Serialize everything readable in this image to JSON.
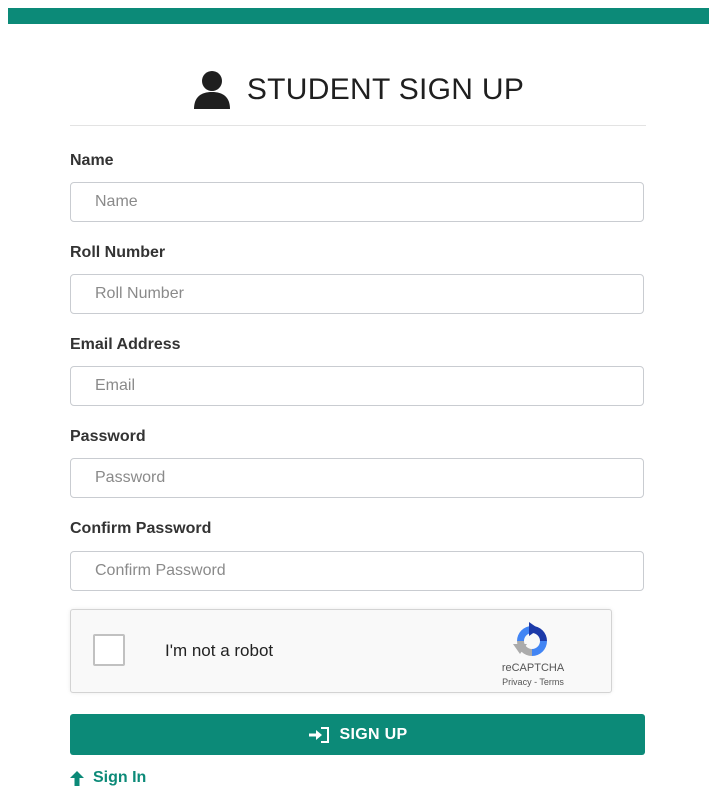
{
  "colors": {
    "brand": "#0c8a78",
    "text": "#333333",
    "input_border": "#c9ccd1"
  },
  "header": {
    "title": "STUDENT SIGN UP",
    "icon": "user-icon"
  },
  "form": {
    "name": {
      "label": "Name",
      "placeholder": "Name",
      "value": ""
    },
    "roll_number": {
      "label": "Roll Number",
      "placeholder": "Roll Number",
      "value": ""
    },
    "email": {
      "label": "Email Address",
      "placeholder": "Email",
      "value": ""
    },
    "password": {
      "label": "Password",
      "placeholder": "Password",
      "value": ""
    },
    "confirm_password": {
      "label": "Confirm Password",
      "placeholder": "Confirm Password",
      "value": ""
    }
  },
  "captcha": {
    "label": "I'm not a robot",
    "brand": "reCAPTCHA",
    "privacy": "Privacy",
    "separator": " - ",
    "terms": "Terms",
    "checked": false
  },
  "actions": {
    "signup_label": "SIGN UP",
    "signup_icon": "sign-in-arrow-icon",
    "signin_label": "Sign In",
    "signin_icon": "arrow-up-icon"
  }
}
